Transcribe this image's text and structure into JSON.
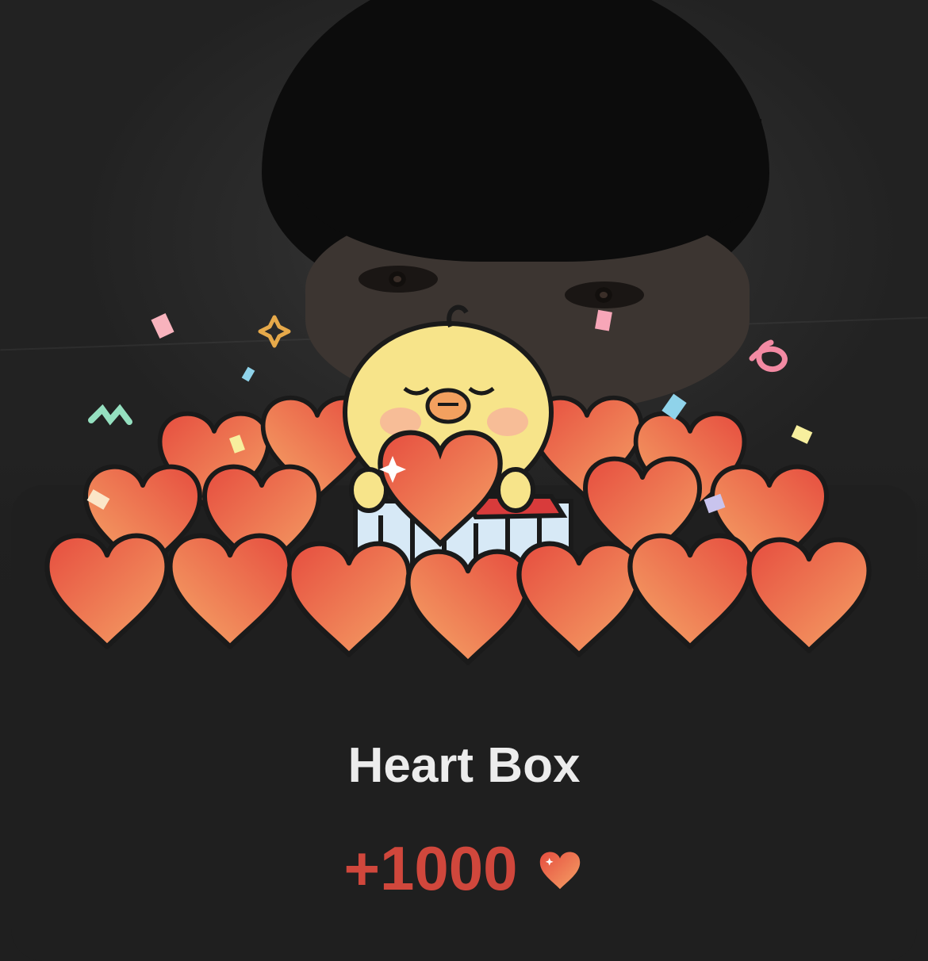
{
  "reward": {
    "title": "Heart Box",
    "amount": "+1000",
    "currency_icon": "heart-icon"
  },
  "colors": {
    "background": "#1f1f1f",
    "title_text": "#ececec",
    "amount_text": "#d0473c",
    "heart_light": "#f5a266",
    "heart_dark": "#e64d3f",
    "chick_body": "#f7e48a"
  }
}
